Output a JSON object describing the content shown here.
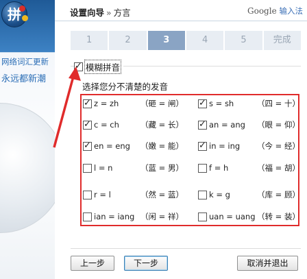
{
  "left": {
    "slogan1": "网络词汇更新",
    "slogan2": "永远都新潮"
  },
  "header": {
    "title": "设置向导",
    "separator": "»",
    "subtitle": "方言",
    "brand_google": "Google",
    "brand_ime": "输入法"
  },
  "steps": [
    "1",
    "2",
    "3",
    "4",
    "5",
    "完成"
  ],
  "active_step": "3",
  "main_checkbox": {
    "label": "模糊拼音",
    "checked": true
  },
  "prompt": "选择您分不清楚的发音",
  "fuzzy_pairs": [
    {
      "label": "z = zh",
      "example": "（砸 = 闸）",
      "checked": true
    },
    {
      "label": "s = sh",
      "example": "（四 = 十）",
      "checked": true
    },
    {
      "label": "c = ch",
      "example": "（藏 = 长）",
      "checked": true
    },
    {
      "label": "an = ang",
      "example": "（眼 = 仰）",
      "checked": true
    },
    {
      "label": "en = eng",
      "example": "（嫩 = 能）",
      "checked": true
    },
    {
      "label": "in = ing",
      "example": "（今 = 经）",
      "checked": true
    },
    {
      "label": "l = n",
      "example": "（蓝 = 男）",
      "checked": false
    },
    {
      "label": "f = h",
      "example": "（福 = 胡）",
      "checked": false
    },
    {
      "label": "r = l",
      "example": "（然 = 蓝）",
      "checked": false
    },
    {
      "label": "k = g",
      "example": "（库 = 顾）",
      "checked": false
    },
    {
      "label": "ian = iang",
      "example": "（闲 = 祥）",
      "checked": false
    },
    {
      "label": "uan = uang",
      "example": "（转 = 装）",
      "checked": false
    }
  ],
  "buttons": {
    "prev": "上一步",
    "next": "下一步",
    "cancel": "取消并退出"
  },
  "colors": {
    "highlight_red": "#e02b2b",
    "active_step": "#8aa4c4",
    "brand_blue": "#2a6db6"
  }
}
